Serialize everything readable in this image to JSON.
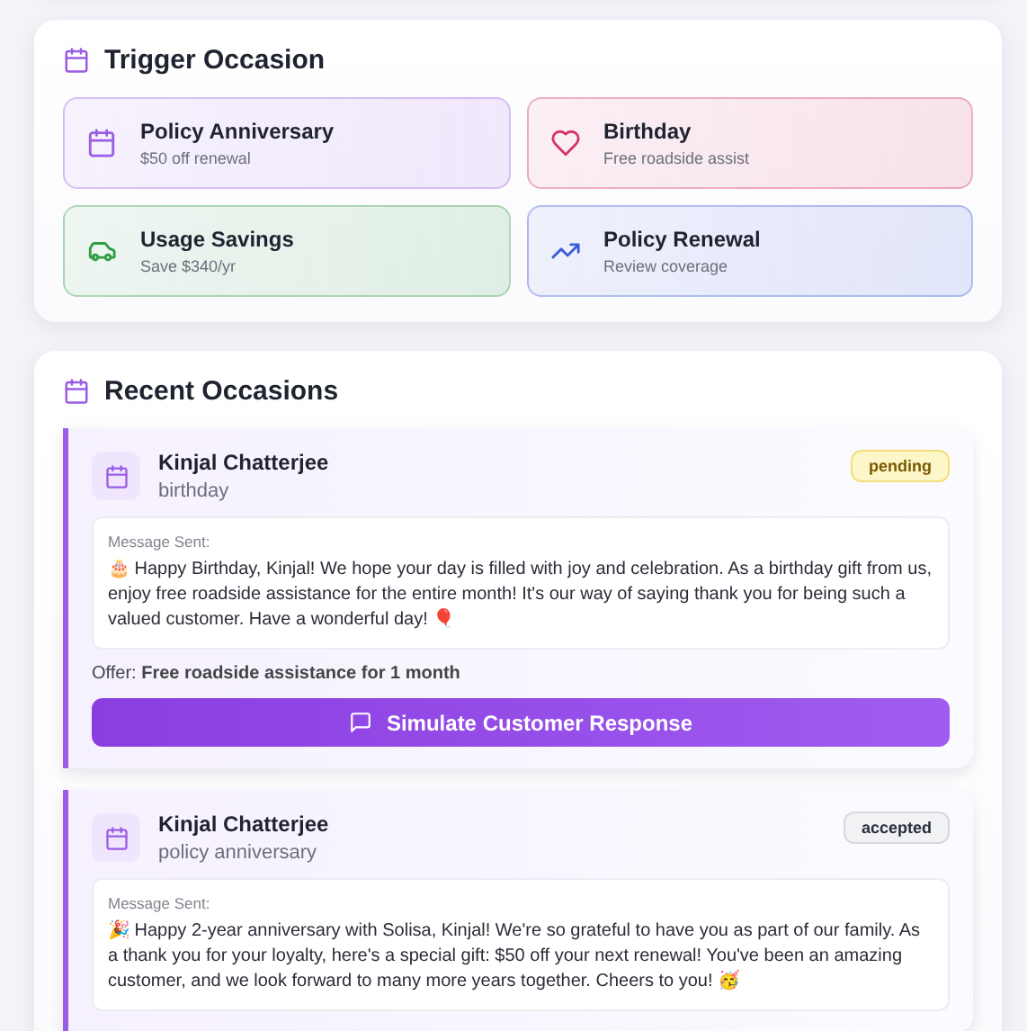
{
  "trigger_occasion": {
    "title": "Trigger Occasion",
    "options": [
      {
        "kind": "calendar",
        "title": "Policy Anniversary",
        "subtitle": "$50 off renewal",
        "color": "#9b5de5"
      },
      {
        "kind": "heart",
        "title": "Birthday",
        "subtitle": "Free roadside assist",
        "color": "#d6336c"
      },
      {
        "kind": "car",
        "title": "Usage Savings",
        "subtitle": "Save $340/yr",
        "color": "#2f9e44"
      },
      {
        "kind": "trend",
        "title": "Policy Renewal",
        "subtitle": "Review coverage",
        "color": "#3b5bdb"
      }
    ]
  },
  "recent_occasions": {
    "title": "Recent Occasions",
    "items": [
      {
        "name": "Kinjal Chatterjee",
        "occasion": "birthday",
        "status": {
          "kind": "pending",
          "label": "pending"
        },
        "message_label": "Message Sent:",
        "message": "🎂 Happy Birthday, Kinjal! We hope your day is filled with joy and celebration. As a birthday gift from us, enjoy free roadside assistance for the entire month! It's our way of saying thank you for being such a valued customer. Have a wonderful day! 🎈",
        "offer": "Offer: **Free roadside assistance for 1 month**",
        "action": "Simulate Customer Response"
      },
      {
        "name": "Kinjal Chatterjee",
        "occasion": "policy anniversary",
        "status": {
          "kind": "accepted",
          "label": "accepted"
        },
        "message_label": "Message Sent:",
        "message": "🎉 Happy 2-year anniversary with Solisa, Kinjal! We're so grateful to have you as part of our family. As a thank you for your loyalty, here's a special gift: $50 off your next renewal! You've been an amazing customer, and we look forward to many more years together. Cheers to you! 🥳"
      }
    ]
  }
}
